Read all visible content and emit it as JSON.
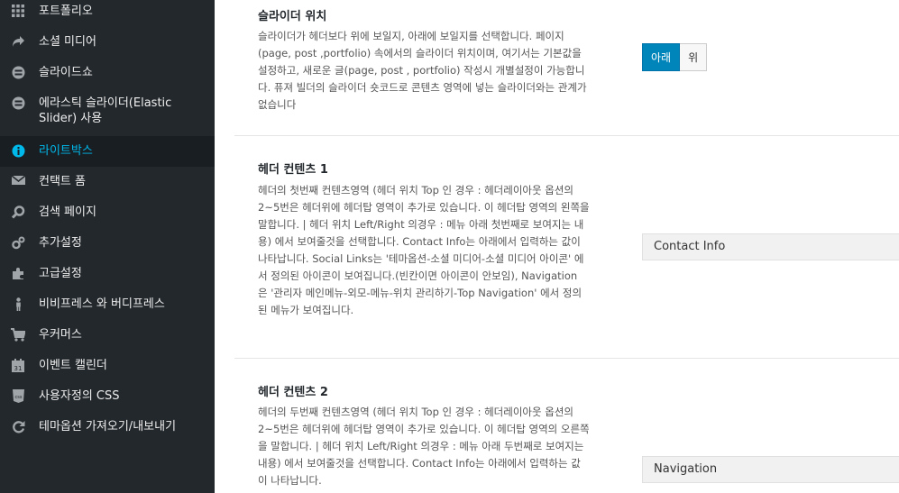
{
  "sidebar": {
    "items": [
      {
        "label": "포트폴리오",
        "icon": "grid-icon"
      },
      {
        "label": "소셜 미디어",
        "icon": "share-icon"
      },
      {
        "label": "슬라이드쇼",
        "icon": "slideshow-icon"
      },
      {
        "label": "에라스틱 슬라이더(Elastic Slider) 사용",
        "icon": "slider-icon"
      },
      {
        "label": "라이트박스",
        "icon": "info-icon",
        "active": true
      },
      {
        "label": "컨택트 폼",
        "icon": "mail-icon"
      },
      {
        "label": "검색 페이지",
        "icon": "search-icon"
      },
      {
        "label": "추가설정",
        "icon": "gears-icon"
      },
      {
        "label": "고급설정",
        "icon": "puzzle-icon"
      },
      {
        "label": "비비프레스 와 버디프레스",
        "icon": "person-icon"
      },
      {
        "label": "우커머스",
        "icon": "cart-icon"
      },
      {
        "label": "이벤트 캘린더",
        "icon": "calendar-icon"
      },
      {
        "label": "사용자정의 CSS",
        "icon": "css-icon"
      },
      {
        "label": "테마옵션 가져오기/내보내기",
        "icon": "refresh-icon"
      }
    ],
    "accent_color": "#00b9eb"
  },
  "sections": {
    "slider_position": {
      "title": "슬라이더 위치",
      "description": "슬라이더가 헤더보다 위에 보일지, 아래에 보일지를 선택합니다. 페이지(page, post ,portfolio) 속에서의 슬라이더 위치이며, 여기서는 기본값을 설정하고, 새로운 글(page, post , portfolio) 작성시 개별설정이 가능합니다. 퓨져 빌더의 슬라이더 숏코드로 콘텐츠 영역에 넣는 슬라이더와는 관계가 없습니다",
      "options": [
        "아래",
        "위"
      ],
      "selected": "아래"
    },
    "header_content_1": {
      "title": "헤더 컨텐츠 1",
      "description": "헤더의 첫번째 컨텐츠영역 (헤더 위치 Top 인 경우 : 헤더레이아웃 옵션의 2~5번은 헤더위에 헤더탑 영역이 추가로 있습니다. 이 헤더탑 영역의 왼쪽을 말합니다. | 헤더 위치 Left/Right 의경우 : 메뉴 아래 첫번째로 보여지는 내용) 에서 보여줄것을 선택합니다. Contact Info는 아래에서 입력하는 값이 나타납니다. Social Links는 '테마옵션-소셜 미디어-소셜 미디어 아이콘' 에서 정의된 아이콘이 보여집니다.(빈칸이면 아이콘이 안보임), Navigation 은 '관리자 메인메뉴-외모-메뉴-위치 관리하기-Top Navigation' 에서 정의된 메뉴가 보여집니다.",
      "value": "Contact Info"
    },
    "header_content_2": {
      "title": "헤더 컨텐츠 2",
      "description": "헤더의 두번째 컨텐츠영역 (헤더 위치 Top 인 경우 : 헤더레이아웃 옵션의 2~5번은 헤더위에 헤더탑 영역이 추가로 있습니다. 이 헤더탑 영역의 오른쪽을 말합니다. | 헤더 위치 Left/Right 의경우 : 메뉴 아래 두번째로 보여지는 내용) 에서 보여줄것을 선택합니다. Contact Info는 아래에서 입력하는 값이 나타납니다.",
      "value": "Navigation"
    }
  }
}
